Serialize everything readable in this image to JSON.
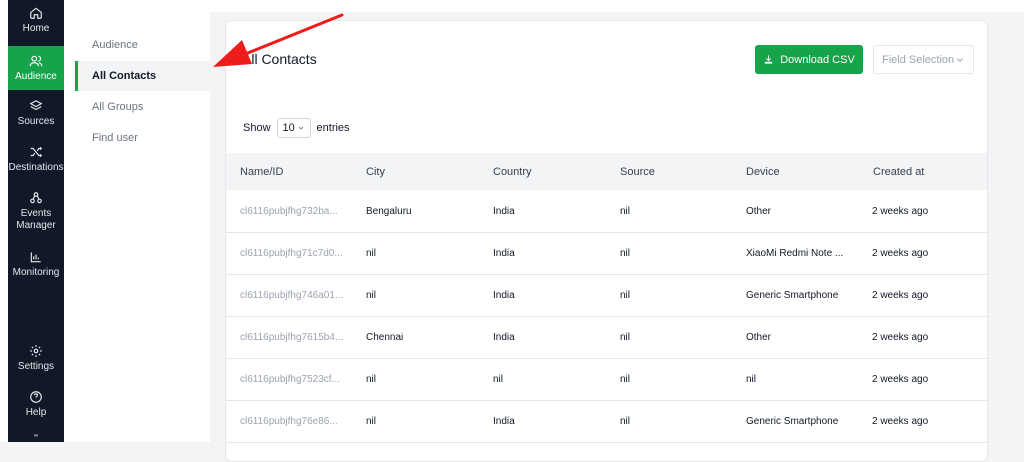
{
  "nav": {
    "items": [
      {
        "label": "Home",
        "icon": "home-icon"
      },
      {
        "label": "Audience",
        "icon": "users-icon",
        "active": true
      },
      {
        "label": "Sources",
        "icon": "layers-icon"
      },
      {
        "label": "Destinations",
        "icon": "shuffle-icon"
      },
      {
        "label": "Events Manager",
        "icon": "nodes-icon"
      },
      {
        "label": "Monitoring",
        "icon": "bar-chart-icon"
      },
      {
        "label": "Settings",
        "icon": "gear-icon"
      },
      {
        "label": "Help",
        "icon": "help-circle-icon"
      }
    ]
  },
  "subnav": {
    "items": [
      {
        "label": "Audience"
      },
      {
        "label": "All Contacts",
        "active": true
      },
      {
        "label": "All Groups"
      },
      {
        "label": "Find user"
      }
    ]
  },
  "main": {
    "title": "All Contacts",
    "download_label": "Download CSV",
    "field_selection_label": "Field Selection",
    "show_label": "Show",
    "entries_value": "10",
    "entries_label": "entries"
  },
  "table": {
    "headers": [
      "Name/ID",
      "City",
      "Country",
      "Source",
      "Device",
      "Created at"
    ],
    "rows": [
      [
        "cl6116pubjfhg732ba...",
        "Bengaluru",
        "India",
        "nil",
        "Other",
        "2 weeks ago"
      ],
      [
        "cl6116pubjfhg71c7d0...",
        "nil",
        "India",
        "nil",
        "XiaoMi Redmi Note ...",
        "2 weeks ago"
      ],
      [
        "cl6116pubjfhg746a01...",
        "nil",
        "India",
        "nil",
        "Generic Smartphone",
        "2 weeks ago"
      ],
      [
        "cl6116pubjfhg7615b4...",
        "Chennai",
        "India",
        "nil",
        "Other",
        "2 weeks ago"
      ],
      [
        "cl6116pubjfhg7523cf...",
        "nil",
        "nil",
        "nil",
        "nil",
        "2 weeks ago"
      ],
      [
        "cl6116pubjfhg76e86...",
        "nil",
        "India",
        "nil",
        "Generic Smartphone",
        "2 weeks ago"
      ]
    ]
  },
  "colors": {
    "accent": "#16a34a",
    "rail": "#111827",
    "annotation_arrow": "#ef1c1c"
  }
}
